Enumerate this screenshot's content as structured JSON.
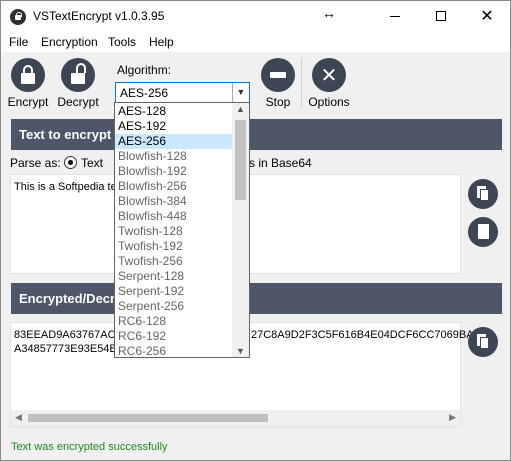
{
  "window": {
    "title": "VSTextEncrypt v1.0.3.95"
  },
  "menu": {
    "items": [
      "File",
      "Encryption",
      "Tools",
      "Help"
    ]
  },
  "toolbar": {
    "encrypt": "Encrypt",
    "decrypt": "Decrypt",
    "algorithm_label": "Algorithm:",
    "algorithm_value": "AES-256",
    "stop": "Stop",
    "options": "Options"
  },
  "dropdown": {
    "options": [
      "AES-128",
      "AES-192",
      "AES-256",
      "Blowfish-128",
      "Blowfish-192",
      "Blowfish-256",
      "Blowfish-384",
      "Blowfish-448",
      "Twofish-128",
      "Twofish-192",
      "Twofish-256",
      "Serpent-128",
      "Serpent-192",
      "Serpent-256",
      "RC6-128",
      "RC6-192",
      "RC6-256"
    ],
    "selected": "AES-256"
  },
  "input_section": {
    "header": "Text to encrypt",
    "parse_label": "Parse as:",
    "option_text": "Text",
    "option_base64_suffix": "s in Base64",
    "content": "This is a Softpedia te"
  },
  "output_section": {
    "header": "Encrypted/Decr",
    "line1_left": "83EEAD9A63767AC6",
    "line1_right": "27C8A9D2F3C5F616B4E04DCF6CC7069BA4",
    "line2_left": "A34857773E93E54BF"
  },
  "status": {
    "message": "Text was encrypted successfully"
  },
  "colors": {
    "header_bg": "#4d5769",
    "button_bg": "#3d4654",
    "status_text": "#1f8a1f",
    "selection": "#cce8ff"
  }
}
